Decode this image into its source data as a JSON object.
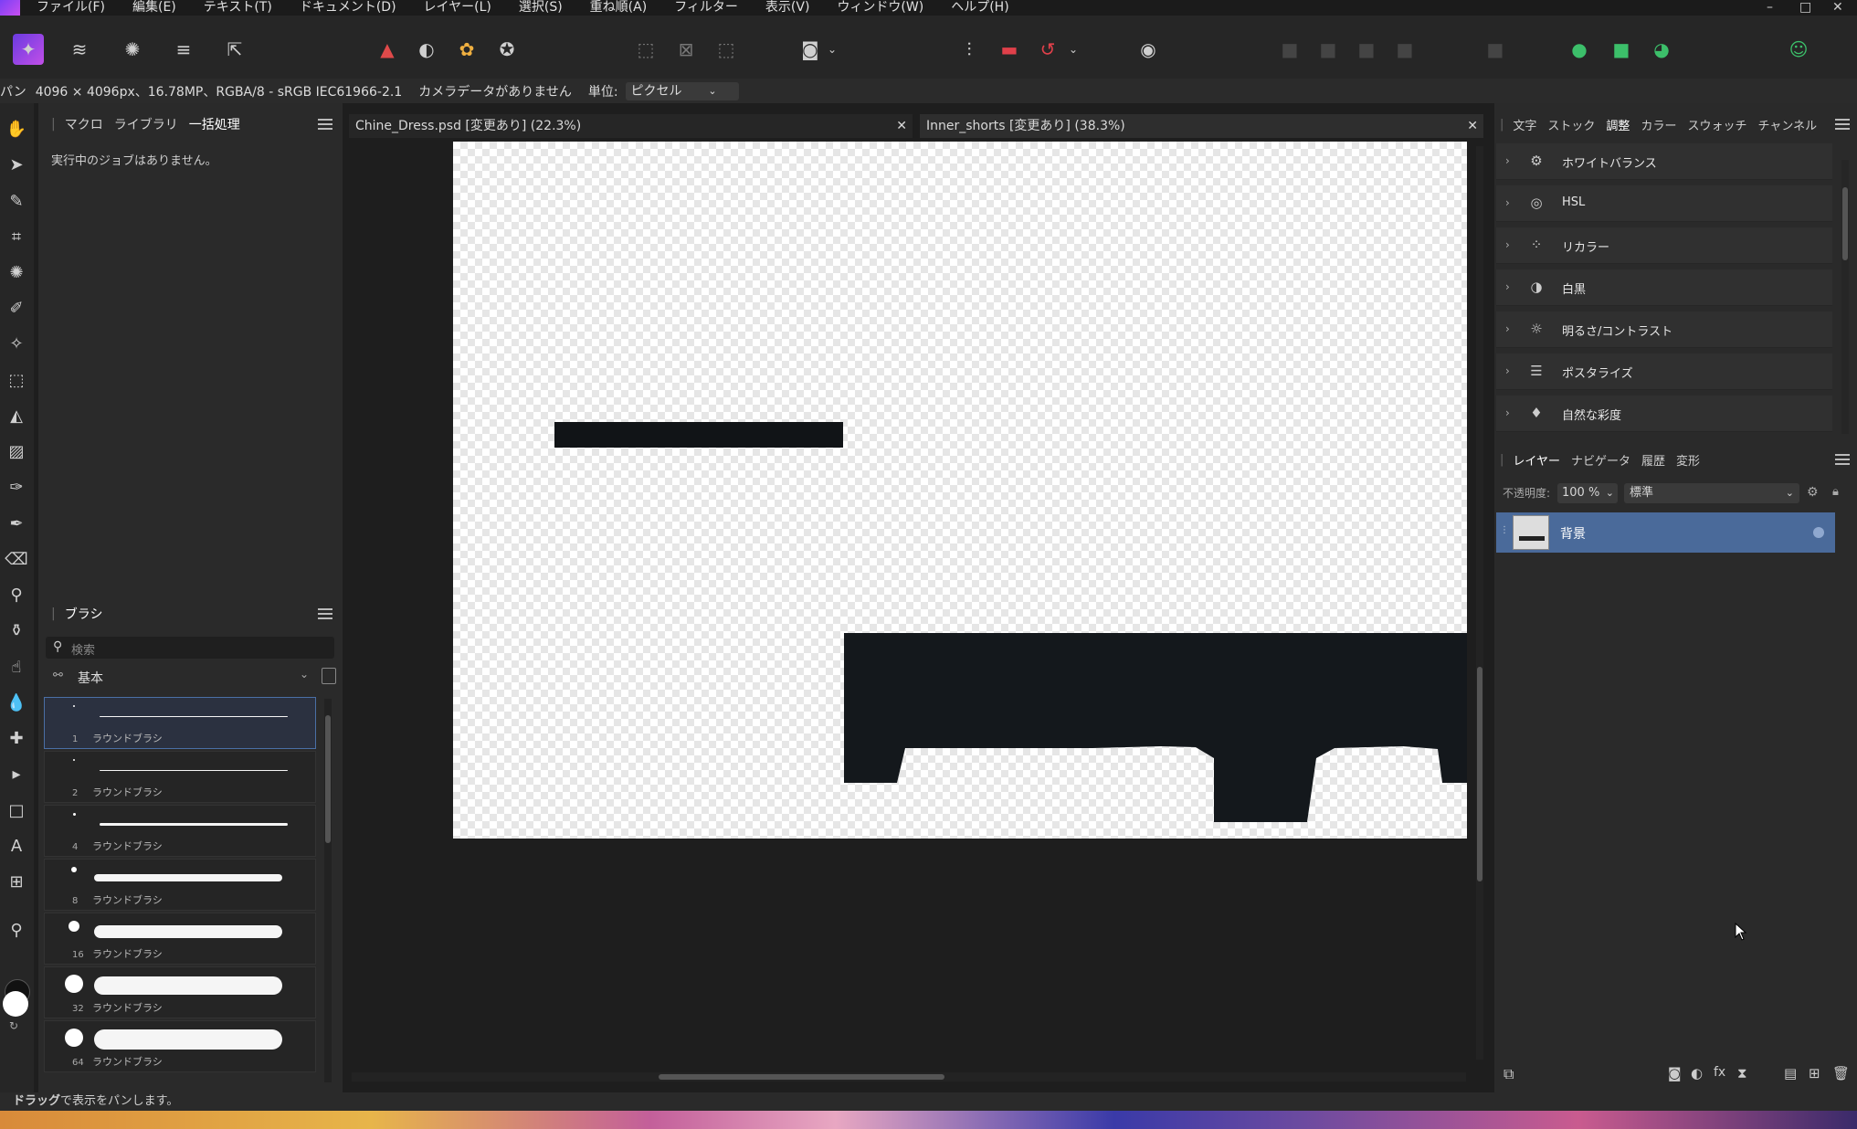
{
  "menubar": {
    "items": [
      "ファイル(F)",
      "編集(E)",
      "テキスト(T)",
      "ドキュメント(D)",
      "レイヤー(L)",
      "選択(S)",
      "重ね順(A)",
      "フィルター",
      "表示(V)",
      "ウィンドウ(W)",
      "ヘルプ(H)"
    ],
    "window_controls": [
      "–",
      "□",
      "✕"
    ]
  },
  "context": {
    "tool_label": "パン",
    "doc_info": "4096 × 4096px、16.78MP、RGBA/8 - sRGB IEC61966-2.1",
    "camera": "カメラデータがありません",
    "unit_label": "単位:",
    "unit_value": "ピクセル"
  },
  "left_panel": {
    "tabs": [
      "マクロ",
      "ライブラリ",
      "一括処理"
    ],
    "active_tab": "一括処理",
    "jobs_text": "実行中のジョブはありません。",
    "brush_panel": {
      "title": "ブラシ",
      "search_placeholder": "検索",
      "category": "基本",
      "brushes": [
        {
          "size": "1",
          "name": "ラウンドブラシ"
        },
        {
          "size": "2",
          "name": "ラウンドブラシ"
        },
        {
          "size": "4",
          "name": "ラウンドブラシ"
        },
        {
          "size": "8",
          "name": "ラウンドブラシ"
        },
        {
          "size": "16",
          "name": "ラウンドブラシ"
        },
        {
          "size": "32",
          "name": "ラウンドブラシ"
        },
        {
          "size": "64",
          "name": "ラウンドブラシ"
        }
      ]
    }
  },
  "documents": {
    "tab1": "Chine_Dress.psd [変更あり] (22.3%)",
    "tab2": "Inner_shorts [変更あり] (38.3%)",
    "close_glyph": "✕"
  },
  "right_panel": {
    "top_tabs": [
      "文字",
      "ストック",
      "調整",
      "カラー",
      "スウォッチ",
      "チャンネル"
    ],
    "active_top_tab": "調整",
    "adjustments": [
      {
        "label": "ホワイトバランス",
        "icon": "white-balance-icon"
      },
      {
        "label": "HSL",
        "icon": "hsl-icon"
      },
      {
        "label": "リカラー",
        "icon": "recolor-icon"
      },
      {
        "label": "白黒",
        "icon": "black-white-icon"
      },
      {
        "label": "明るさ/コントラスト",
        "icon": "brightness-contrast-icon"
      },
      {
        "label": "ポスタライズ",
        "icon": "posterize-icon"
      },
      {
        "label": "自然な彩度",
        "icon": "vibrance-icon"
      }
    ],
    "layer_tabs": [
      "レイヤー",
      "ナビゲータ",
      "履歴",
      "変形"
    ],
    "active_layer_tab": "レイヤー",
    "opacity_label": "不透明度:",
    "opacity_value": "100 %",
    "blend_mode": "標準",
    "layers": [
      {
        "name": "背景"
      }
    ]
  },
  "status": {
    "bold": "ドラッグ",
    "text": "で表示をパンします。"
  },
  "colors": {
    "accent": "#4a6fa5",
    "layer_selected": "#4a6a9a"
  }
}
